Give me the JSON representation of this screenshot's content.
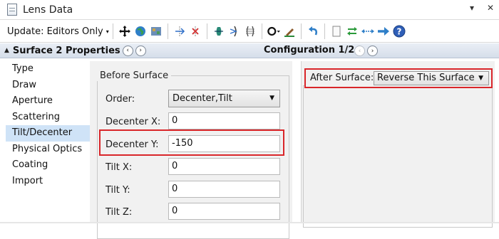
{
  "window": {
    "title": "Lens Data",
    "pin_glyph": "▾",
    "close_glyph": "✕",
    "doc_icon": "document-icon"
  },
  "toolbar": {
    "update_label": "Update: Editors Only",
    "update_caret": "▾",
    "icons": [
      "move-crosshair-icon",
      "globe-icon",
      "map-icon",
      "insert-surface-icon",
      "delete-surface-icon",
      "lens-element-icon",
      "arrow-lens-icon",
      "grid-lens-icon",
      "ring-icon",
      "paint-brush-icon",
      "undo-arrow-icon",
      "blank-page-icon",
      "swap-arrows-icon",
      "double-arrow-icon",
      "forward-arrow-icon",
      "help-icon"
    ]
  },
  "propbar": {
    "collapse_glyph": "▲",
    "title": "Surface 2 Properties",
    "prev_glyph": "‹",
    "next_glyph": "›",
    "config_title": "Configuration 1/2"
  },
  "nav": {
    "items": [
      {
        "label": "Type"
      },
      {
        "label": "Draw"
      },
      {
        "label": "Aperture"
      },
      {
        "label": "Scattering"
      },
      {
        "label": "Tilt/Decenter"
      },
      {
        "label": "Physical Optics"
      },
      {
        "label": "Coating"
      },
      {
        "label": "Import"
      }
    ],
    "selected": "Tilt/Decenter"
  },
  "before_surface": {
    "legend": "Before Surface",
    "order_label": "Order:",
    "order_value": "Decenter,Tilt",
    "select_caret": "▼",
    "decenter_x_label": "Decenter X:",
    "decenter_x_value": "0",
    "decenter_y_label": "Decenter Y:",
    "decenter_y_value": "-150",
    "tilt_x_label": "Tilt X:",
    "tilt_x_value": "0",
    "tilt_y_label": "Tilt Y:",
    "tilt_y_value": "0",
    "tilt_z_label": "Tilt Z:",
    "tilt_z_value": "0"
  },
  "after_surface": {
    "label": "After Surface:",
    "value": "Reverse This Surface",
    "select_caret": "▼"
  },
  "colors": {
    "highlight_border": "#d9262a",
    "selected_nav": "#cfe3f7",
    "propbar_top": "#e9eef5",
    "propbar_bottom": "#d6deea"
  }
}
